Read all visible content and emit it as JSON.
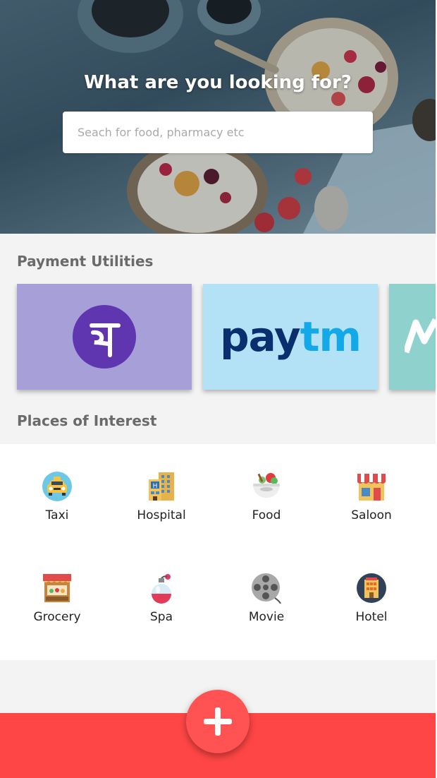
{
  "hero": {
    "title": "What are you looking for?",
    "search_placeholder": "Seach for food, pharmacy etc",
    "search_value": ""
  },
  "payment": {
    "heading": "Payment Utilities",
    "cards": [
      {
        "name": "PhonePe",
        "logo_glyph": "पे",
        "color": "#a79fd8"
      },
      {
        "name": "Paytm",
        "logo_pay": "pay",
        "logo_tm": "tm",
        "color": "#b3e2f6"
      },
      {
        "name": "Mobikwik",
        "color": "#8fd1cd"
      }
    ]
  },
  "places": {
    "heading": "Places of Interest",
    "items": [
      {
        "label": "Taxi",
        "icon": "taxi-icon"
      },
      {
        "label": "Hospital",
        "icon": "hospital-icon"
      },
      {
        "label": "Food",
        "icon": "food-icon"
      },
      {
        "label": "Saloon",
        "icon": "saloon-icon"
      },
      {
        "label": "Grocery",
        "icon": "grocery-icon"
      },
      {
        "label": "Spa",
        "icon": "spa-icon"
      },
      {
        "label": "Movie",
        "icon": "movie-icon"
      },
      {
        "label": "Hotel",
        "icon": "hotel-icon"
      }
    ]
  },
  "fab": {
    "icon": "plus-icon"
  },
  "colors": {
    "accent": "#ff4646",
    "fab": "#ff5252",
    "background": "#f3f3f3",
    "heading_text": "#6a6a6a"
  }
}
